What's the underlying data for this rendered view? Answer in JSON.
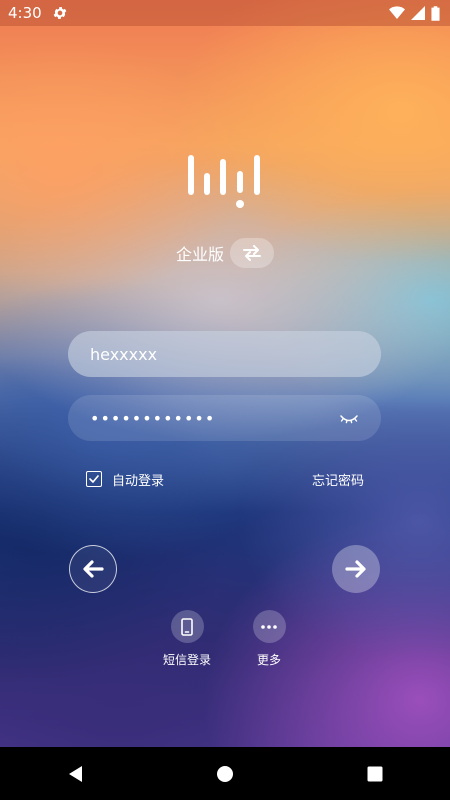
{
  "status_bar": {
    "time": "4:30",
    "icons": [
      "gear-icon",
      "wifi-icon",
      "signal-icon",
      "battery-icon"
    ]
  },
  "app": {
    "logo_icon": "bars-logo-icon",
    "edition_label": "企业版",
    "switch_icon": "swap-arrows-icon"
  },
  "login_form": {
    "username_value": "hexxxxx",
    "password_value": "••••••••••••",
    "password_toggle_icon": "eye-closed-icon",
    "auto_login_label": "自动登录",
    "auto_login_checked": true,
    "forgot_password_label": "忘记密码"
  },
  "actions": {
    "back_icon": "arrow-left-icon",
    "next_icon": "arrow-right-icon"
  },
  "alt_login": [
    {
      "label": "短信登录",
      "icon": "phone-icon"
    },
    {
      "label": "更多",
      "icon": "more-icon"
    }
  ],
  "nav_bar": {
    "icons": [
      "back-triangle-icon",
      "home-circle-icon",
      "recents-square-icon"
    ]
  },
  "colors": {
    "text": "#ffffff",
    "nav_background": "#000000"
  }
}
